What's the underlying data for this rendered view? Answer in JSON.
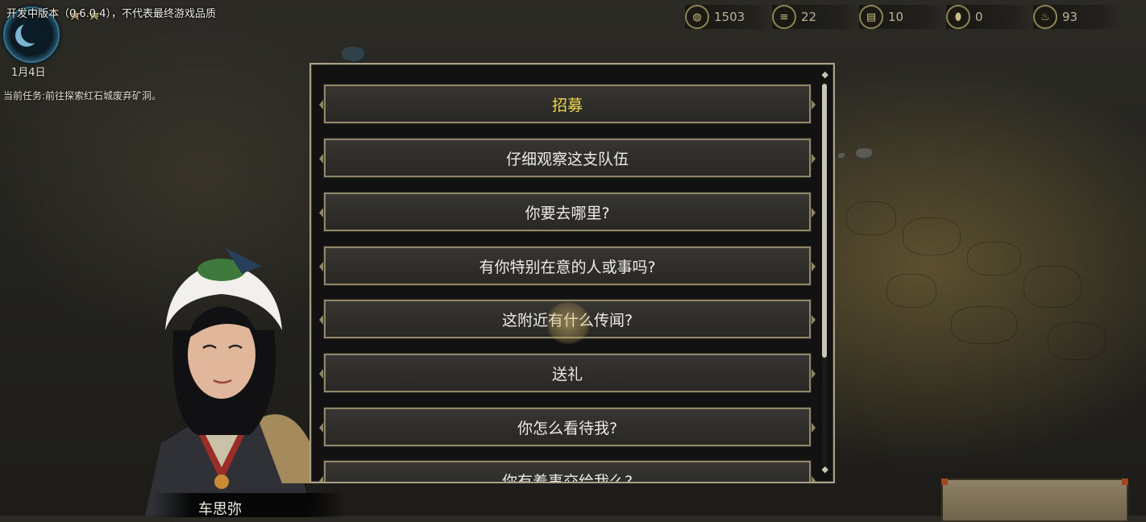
{
  "hud": {
    "dev_note": "开发中版本（0.6.0.4），不代表最终游戏品质",
    "date": "1月4日",
    "task": "当前任务:前往探索红石城废弃矿洞。",
    "stars": "★★"
  },
  "resources": [
    {
      "icon": "coin-icon",
      "value": "1503"
    },
    {
      "icon": "wood-icon",
      "value": "22"
    },
    {
      "icon": "iron-icon",
      "value": "10"
    },
    {
      "icon": "gem-icon",
      "value": "0"
    },
    {
      "icon": "fire-icon",
      "value": "93"
    }
  ],
  "dialogue": {
    "options": [
      {
        "label": "招募",
        "highlight": true
      },
      {
        "label": "仔细观察这支队伍"
      },
      {
        "label": "你要去哪里?"
      },
      {
        "label": "有你特别在意的人或事吗?"
      },
      {
        "label": "这附近有什么传闻?"
      },
      {
        "label": "送礼"
      },
      {
        "label": "你怎么看待我?"
      },
      {
        "label": "你有着事交给我么?"
      }
    ]
  },
  "character": {
    "name": "车思弥"
  },
  "colors": {
    "highlight_text": "#f0d84a",
    "option_border": "#8f8868",
    "panel_border": "#a9a289"
  }
}
